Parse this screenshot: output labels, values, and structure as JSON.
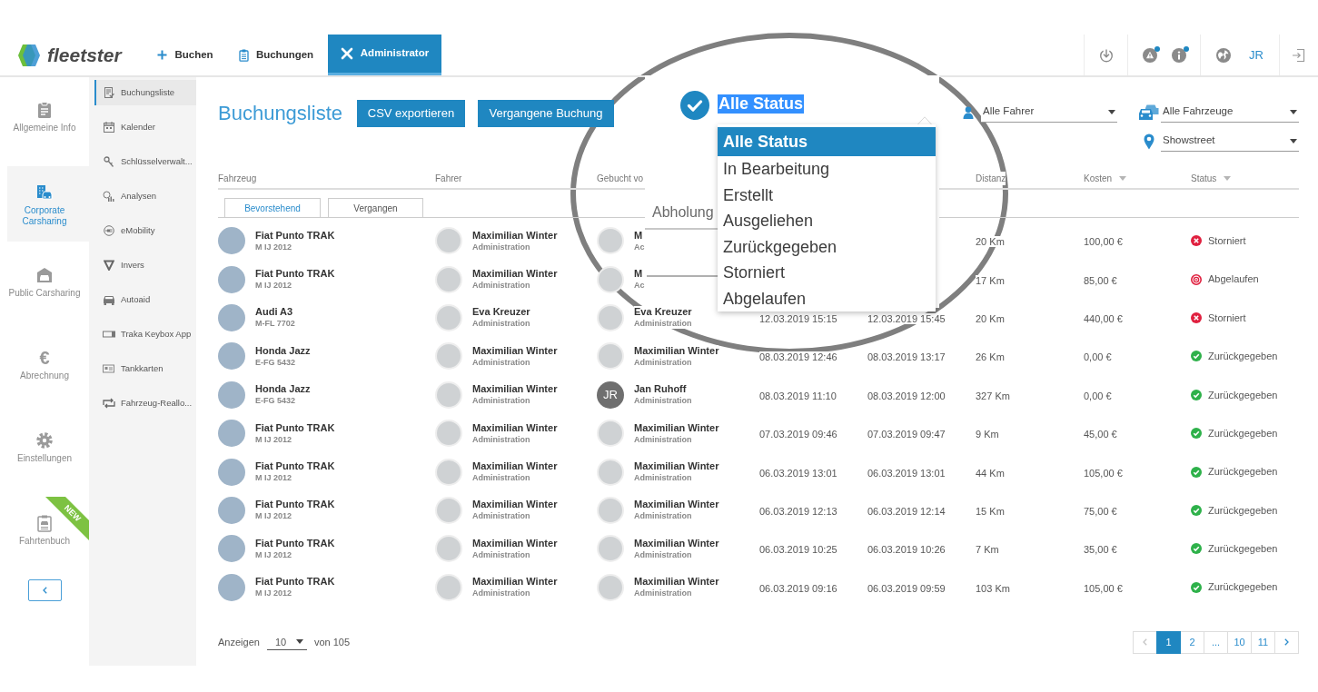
{
  "brand": "fleetster",
  "nav_tabs": [
    {
      "label": "Buchen",
      "selected": false
    },
    {
      "label": "Buchungen",
      "selected": false
    },
    {
      "label": "Administrator",
      "selected": true
    }
  ],
  "header_action_groups": [
    {
      "items": [
        {
          "kind": "icon",
          "unread": false
        }
      ]
    },
    {
      "items": [
        {
          "kind": "icon",
          "unread": true
        },
        {
          "kind": "icon",
          "unread": true
        }
      ]
    },
    {
      "items": [
        {
          "kind": "icon",
          "unread": false
        },
        {
          "kind": "text",
          "label": "JR"
        }
      ]
    },
    {
      "items": [
        {
          "kind": "icon",
          "unread": false
        }
      ]
    }
  ],
  "main_sidebar": [
    {
      "label": "Allgemeine Info",
      "selected": false
    },
    {
      "label": "Corporate Carsharing",
      "selected": true
    },
    {
      "label": "Public Carsharing",
      "selected": false
    },
    {
      "label": "Abrechnung",
      "selected": false,
      "icon_text": "€"
    },
    {
      "label": "Einstellungen",
      "selected": false
    },
    {
      "label": "Fahrtenbuch",
      "selected": false,
      "ribbon": "NEW"
    }
  ],
  "sub_sidebar": [
    {
      "label": "Buchungsliste",
      "selected": true
    },
    {
      "label": "Kalender",
      "selected": false
    },
    {
      "label": "Schlüsselverwalt...",
      "selected": false
    },
    {
      "label": "Analysen",
      "selected": false
    },
    {
      "label": "eMobility",
      "selected": false
    },
    {
      "label": "Invers",
      "selected": false
    },
    {
      "label": "Autoaid",
      "selected": false
    },
    {
      "label": "Traka Keybox App",
      "selected": false
    },
    {
      "label": "Tankkarten",
      "selected": false
    },
    {
      "label": "Fahrzeug-Reallo...",
      "selected": false
    }
  ],
  "page_title": "Buchungsliste",
  "actions": [
    {
      "label": "CSV exportieren"
    },
    {
      "label": "Vergangene Buchung"
    }
  ],
  "filters": [
    {
      "value": "Alle Fahrer"
    },
    {
      "value": "Alle Fahrzeuge"
    },
    {
      "value": "Showstreet"
    }
  ],
  "table": {
    "columns": [
      {
        "label": "Fahrzeug",
        "sortable": false
      },
      {
        "label": "Fahrer",
        "sortable": false
      },
      {
        "label": "Gebucht vo",
        "sortable": false
      },
      null,
      null,
      {
        "label": "Distanz",
        "sortable": false
      },
      {
        "label": "Kosten",
        "sortable": true
      },
      {
        "label": "Status",
        "sortable": true
      }
    ],
    "tabs": [
      {
        "label": "Bevorstehend",
        "selected": false
      },
      {
        "label": "Vergangen",
        "selected": true
      }
    ],
    "rows": [
      {
        "vehicle": {
          "name": "Fiat Punto TRAK",
          "plate": "M IJ 2012"
        },
        "driver": {
          "name": "Maximilian Winter",
          "role": "Administration"
        },
        "booked_by": {
          "name": "M",
          "role": "Ac"
        },
        "distance": "20 Km",
        "cost": "100,00 €",
        "status": {
          "label": "Storniert",
          "kind": "cancelled"
        }
      },
      {
        "vehicle": {
          "name": "Fiat Punto TRAK",
          "plate": "M IJ 2012"
        },
        "driver": {
          "name": "Maximilian Winter",
          "role": "Administration"
        },
        "booked_by": {
          "name": "M",
          "role": "Ac"
        },
        "distance": "17 Km",
        "cost": "85,00 €",
        "status": {
          "label": "Abgelaufen",
          "kind": "expired"
        }
      },
      {
        "vehicle": {
          "name": "Audi A3",
          "plate": "M-FL 7702"
        },
        "driver": {
          "name": "Eva Kreuzer",
          "role": "Administration"
        },
        "booked_by": {
          "name": "Eva Kreuzer",
          "role": "Administration"
        },
        "start": "12.03.2019 15:15",
        "end": "12.03.2019 15:45",
        "distance": "20 Km",
        "cost": "440,00 €",
        "status": {
          "label": "Storniert",
          "kind": "cancelled"
        }
      },
      {
        "vehicle": {
          "name": "Honda Jazz",
          "plate": "E-FG 5432"
        },
        "driver": {
          "name": "Maximilian Winter",
          "role": "Administration"
        },
        "booked_by": {
          "name": "Maximilian Winter",
          "role": "Administration"
        },
        "start": "08.03.2019 12:46",
        "end": "08.03.2019 13:17",
        "distance": "26 Km",
        "cost": "0,00 €",
        "status": {
          "label": "Zurückgegeben",
          "kind": "returned"
        }
      },
      {
        "vehicle": {
          "name": "Honda Jazz",
          "plate": "E-FG 5432"
        },
        "driver": {
          "name": "Maximilian Winter",
          "role": "Administration"
        },
        "booked_by": {
          "name": "Jan Ruhoff",
          "role": "Administration",
          "initials": "JR"
        },
        "start": "08.03.2019 11:10",
        "end": "08.03.2019 12:00",
        "distance": "327 Km",
        "cost": "0,00 €",
        "status": {
          "label": "Zurückgegeben",
          "kind": "returned"
        }
      },
      {
        "vehicle": {
          "name": "Fiat Punto TRAK",
          "plate": "M IJ 2012"
        },
        "driver": {
          "name": "Maximilian Winter",
          "role": "Administration"
        },
        "booked_by": {
          "name": "Maximilian Winter",
          "role": "Administration"
        },
        "start": "07.03.2019 09:46",
        "end": "07.03.2019 09:47",
        "distance": "9 Km",
        "cost": "45,00 €",
        "status": {
          "label": "Zurückgegeben",
          "kind": "returned"
        }
      },
      {
        "vehicle": {
          "name": "Fiat Punto TRAK",
          "plate": "M IJ 2012"
        },
        "driver": {
          "name": "Maximilian Winter",
          "role": "Administration"
        },
        "booked_by": {
          "name": "Maximilian Winter",
          "role": "Administration"
        },
        "start": "06.03.2019 13:01",
        "end": "06.03.2019 13:01",
        "distance": "44 Km",
        "cost": "105,00 €",
        "status": {
          "label": "Zurückgegeben",
          "kind": "returned"
        }
      },
      {
        "vehicle": {
          "name": "Fiat Punto TRAK",
          "plate": "M IJ 2012"
        },
        "driver": {
          "name": "Maximilian Winter",
          "role": "Administration"
        },
        "booked_by": {
          "name": "Maximilian Winter",
          "role": "Administration"
        },
        "start": "06.03.2019 12:13",
        "end": "06.03.2019 12:14",
        "distance": "15 Km",
        "cost": "75,00 €",
        "status": {
          "label": "Zurückgegeben",
          "kind": "returned"
        }
      },
      {
        "vehicle": {
          "name": "Fiat Punto TRAK",
          "plate": "M IJ 2012"
        },
        "driver": {
          "name": "Maximilian Winter",
          "role": "Administration"
        },
        "booked_by": {
          "name": "Maximilian Winter",
          "role": "Administration"
        },
        "start": "06.03.2019 10:25",
        "end": "06.03.2019 10:26",
        "distance": "7 Km",
        "cost": "35,00 €",
        "status": {
          "label": "Zurückgegeben",
          "kind": "returned"
        }
      },
      {
        "vehicle": {
          "name": "Fiat Punto TRAK",
          "plate": "M IJ 2012"
        },
        "driver": {
          "name": "Maximilian Winter",
          "role": "Administration"
        },
        "booked_by": {
          "name": "Maximilian Winter",
          "role": "Administration"
        },
        "start": "06.03.2019 09:16",
        "end": "06.03.2019 09:59",
        "distance": "103 Km",
        "cost": "105,00 €",
        "status": {
          "label": "Zurückgegeben",
          "kind": "returned"
        }
      }
    ]
  },
  "footer": {
    "page_size_label": "Anzeigen",
    "page_size": "10",
    "total": "von 105",
    "pagination": [
      {
        "kind": "prev",
        "selected": false,
        "disabled": true
      },
      {
        "kind": "page",
        "label": "1",
        "selected": true,
        "disabled": false
      },
      {
        "kind": "page",
        "label": "2",
        "selected": false,
        "disabled": false
      },
      {
        "kind": "ellipsis",
        "label": "...",
        "selected": false,
        "disabled": false
      },
      {
        "kind": "page",
        "label": "10",
        "selected": false,
        "disabled": false
      },
      {
        "kind": "page",
        "label": "11",
        "selected": false,
        "disabled": false
      },
      {
        "kind": "next",
        "selected": false,
        "disabled": false
      }
    ]
  },
  "magnifier": {
    "status_filter": {
      "value": "Alle Status",
      "text_highlighted": true,
      "open": true,
      "options": [
        {
          "label": "Alle Status",
          "selected": true
        },
        {
          "label": "In Bearbeitung",
          "selected": false
        },
        {
          "label": "Erstellt",
          "selected": false
        },
        {
          "label": "Ausgeliehen",
          "selected": false
        },
        {
          "label": "Zurückgegeben",
          "selected": false
        },
        {
          "label": "Storniert",
          "selected": false
        },
        {
          "label": "Abgelaufen",
          "selected": false
        }
      ]
    },
    "column_header": "Abholung"
  }
}
